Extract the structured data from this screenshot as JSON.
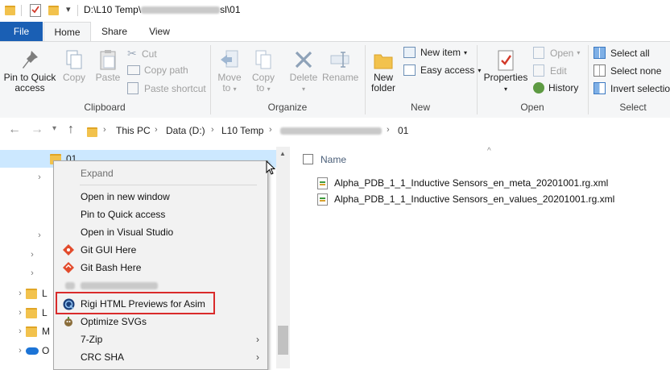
{
  "window": {
    "path_prefix": "D:\\L10 Temp\\",
    "path_suffix": "sl\\01"
  },
  "tabs": {
    "file": "File",
    "home": "Home",
    "share": "Share",
    "view": "View"
  },
  "ribbon": {
    "clipboard": {
      "label": "Clipboard",
      "pin_line1": "Pin to Quick",
      "pin_line2": "access",
      "copy": "Copy",
      "paste": "Paste",
      "cut": "Cut",
      "copy_path": "Copy path",
      "paste_shortcut": "Paste shortcut"
    },
    "organize": {
      "label": "Organize",
      "move_line1": "Move",
      "move_line2": "to",
      "copy_line1": "Copy",
      "copy_line2": "to",
      "delete": "Delete",
      "rename": "Rename"
    },
    "new": {
      "label": "New",
      "new_folder_line1": "New",
      "new_folder_line2": "folder",
      "new_item": "New item",
      "easy_access": "Easy access"
    },
    "open": {
      "label": "Open",
      "properties": "Properties",
      "open": "Open",
      "edit": "Edit",
      "history": "History"
    },
    "select": {
      "label": "Select",
      "select_all": "Select all",
      "select_none": "Select none",
      "invert_selection": "Invert selection"
    }
  },
  "address": {
    "crumbs": [
      "This PC",
      "Data (D:)",
      "L10 Temp",
      "01"
    ]
  },
  "tree": {
    "selected": "01",
    "items": [
      "L",
      "L",
      "M",
      "O"
    ]
  },
  "files": {
    "column_name": "Name",
    "rows": [
      "Alpha_PDB_1_1_Inductive Sensors_en_meta_20201001.rg.xml",
      "Alpha_PDB_1_1_Inductive Sensors_en_values_20201001.rg.xml"
    ]
  },
  "context_menu": {
    "expand": "Expand",
    "open_new_window": "Open in new window",
    "pin_quick_access": "Pin to Quick access",
    "open_visual_studio": "Open in Visual Studio",
    "git_gui": "Git GUI Here",
    "git_bash": "Git Bash Here",
    "rigi": "Rigi HTML Previews for Asim",
    "optimize_svgs": "Optimize SVGs",
    "seven_zip": "7-Zip",
    "crc_sha": "CRC SHA"
  },
  "colors": {
    "accent": "#1a5fb4",
    "highlight": "#d92b2b",
    "folder": "#f2c24d"
  }
}
